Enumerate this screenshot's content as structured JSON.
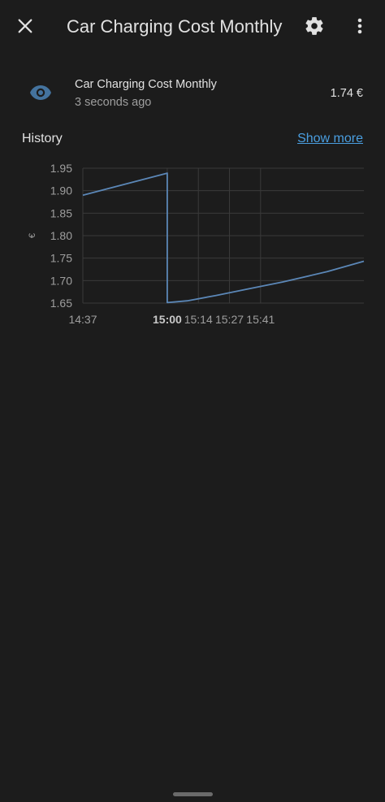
{
  "header": {
    "title": "Car Charging Cost Monthly",
    "close_icon": "close-icon",
    "settings_icon": "gear-icon",
    "more_icon": "more-vert-icon"
  },
  "entity": {
    "icon": "eye-icon",
    "name": "Car Charging Cost Monthly",
    "last_changed": "3 seconds ago",
    "state": "1.74 €"
  },
  "history": {
    "title": "History",
    "show_more": "Show more"
  },
  "colors": {
    "background": "#1c1c1c",
    "accent": "#4a9ee0",
    "series": "#5b87b7",
    "icon": "#44739e"
  },
  "chart_data": {
    "type": "line",
    "ylabel": "€",
    "ylim": [
      1.65,
      1.95
    ],
    "yticks": [
      "1.95",
      "1.90",
      "1.85",
      "1.80",
      "1.75",
      "1.70",
      "1.65"
    ],
    "xticks": [
      {
        "label": "14:37",
        "bold": false
      },
      {
        "label": "15:00",
        "bold": true
      },
      {
        "label": "15:14",
        "bold": false
      },
      {
        "label": "15:27",
        "bold": false
      },
      {
        "label": "15:41",
        "bold": false
      }
    ],
    "grid": true,
    "series": [
      {
        "x_minutes": [
          0,
          38,
          38,
          47,
          60,
          75,
          90,
          110,
          126.5
        ],
        "values": [
          1.89,
          1.939,
          1.651,
          1.655,
          1.667,
          1.682,
          1.697,
          1.72,
          1.743
        ]
      }
    ]
  }
}
